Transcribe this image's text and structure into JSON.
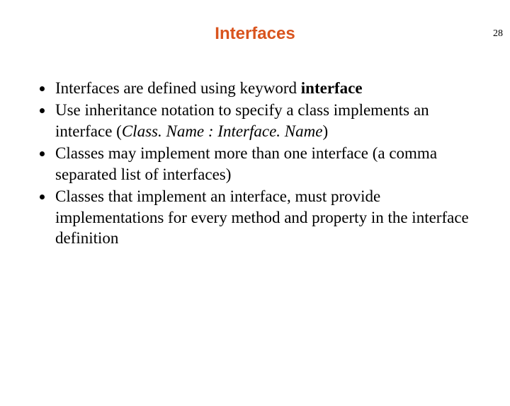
{
  "page_number": "28",
  "title": "Interfaces",
  "bullets": {
    "b1a": "Interfaces are defined using keyword ",
    "b1b": "interface",
    "b2a": "Use inheritance notation to specify a class implements an interface (",
    "b2b": "Class. Name : Interface. Name",
    "b2c": ")",
    "b3": "Classes may implement more than one interface (a comma separated list of interfaces)",
    "b4": "Classes that implement an interface, must provide implementations for every method and property in the interface definition"
  }
}
